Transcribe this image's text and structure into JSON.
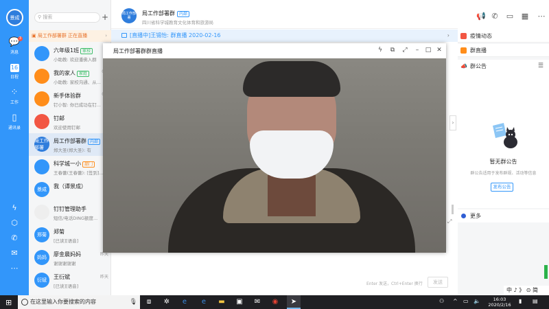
{
  "nav": {
    "avatar_text": "景成",
    "items": [
      {
        "label": "消息",
        "icon": "message-icon",
        "badge": "3"
      },
      {
        "label": "日程",
        "icon": "calendar-icon",
        "num": "16"
      },
      {
        "label": "工作",
        "icon": "grid-icon"
      },
      {
        "label": "通讯录",
        "icon": "contacts-icon"
      }
    ]
  },
  "list": {
    "search_placeholder": "搜索",
    "add_label": "+",
    "live_bar": "局工作部署群 正在直播",
    "conversations": [
      {
        "name": "六年级1班",
        "tag": "家校",
        "tag_color": "green",
        "msg": "小助教: 欢迎潘佛入群",
        "time": "",
        "avatar": "",
        "color": "#3296fa"
      },
      {
        "name": "我的家人",
        "tag": "家庭",
        "tag_color": "green",
        "msg": "小助教: 家校沟通、从...",
        "time": "02-",
        "avatar": "",
        "color": "#ff8d1a"
      },
      {
        "name": "新手体验群",
        "tag": "",
        "tag_color": "",
        "msg": "钉小智: 你已成功在钉...",
        "time": "02-",
        "avatar": "",
        "color": "#ff8d1a"
      },
      {
        "name": "钉邮",
        "tag": "",
        "tag_color": "",
        "msg": "欢迎使用钉邮",
        "time": "",
        "avatar": "",
        "color": "#f25643"
      },
      {
        "name": "局工作部署群",
        "tag": "内部",
        "tag_color": "blue",
        "msg": "郑大圣(郑大圣): 有",
        "time": "16",
        "avatar": "局工作部署",
        "color": "#2f7ddc",
        "badge": "1"
      },
      {
        "name": "科学城一小",
        "tag": "部门",
        "tag_color": "orange",
        "msg": "王春蕾(王春蕾): [签到]...",
        "time": "13",
        "avatar": "",
        "color": "#3296fa"
      },
      {
        "name": "我（谭景成）",
        "tag": "",
        "tag_color": "",
        "msg": "",
        "time": "",
        "avatar": "景成",
        "color": "#3296fa"
      },
      {
        "name": "钉钉管理助手",
        "tag": "",
        "tag_color": "",
        "msg": "短信/电话DING额度...",
        "time": "15",
        "avatar": "",
        "color": "#eeeeee"
      },
      {
        "name": "郑菊",
        "tag": "",
        "tag_color": "",
        "msg": "[已读][语音]",
        "time": "",
        "avatar": "郑菊",
        "color": "#3296fa"
      },
      {
        "name": "廖金晨妈妈",
        "tag": "",
        "tag_color": "",
        "msg": "谢谢谢谢谢",
        "time": "昨天",
        "avatar": "妈妈",
        "color": "#3296fa"
      },
      {
        "name": "王衍斌",
        "tag": "",
        "tag_color": "",
        "msg": "[已读][语音]",
        "time": "昨天",
        "avatar": "衍斌",
        "color": "#3296fa"
      }
    ]
  },
  "chat": {
    "group_avatar": "局工作部署",
    "title": "局工作部署群",
    "inner_tag": "内部",
    "org": "四川省科学城教育文化体育和旅游局",
    "live_banner": "[直播中]王锡怡: 群直播 2020-02-16",
    "input_hint": "Enter 发送，Ctrl+Enter 换行",
    "send_label": "发送"
  },
  "popup": {
    "title": "局工作部署群群直播"
  },
  "right": {
    "epidemic": "疫情动态",
    "live": "群直播",
    "notice_header": "群公告",
    "no_notice": "暂无群公告",
    "notice_desc": "群公告适用于发布群规、活动等信息",
    "publish": "发布公告",
    "more": "更多"
  },
  "taskbar": {
    "search_text": "在这里输入你要搜索的内容",
    "time": "16:03",
    "date": "2020/2/16",
    "ime": "中 ♪ 》 ⊙ 简"
  }
}
